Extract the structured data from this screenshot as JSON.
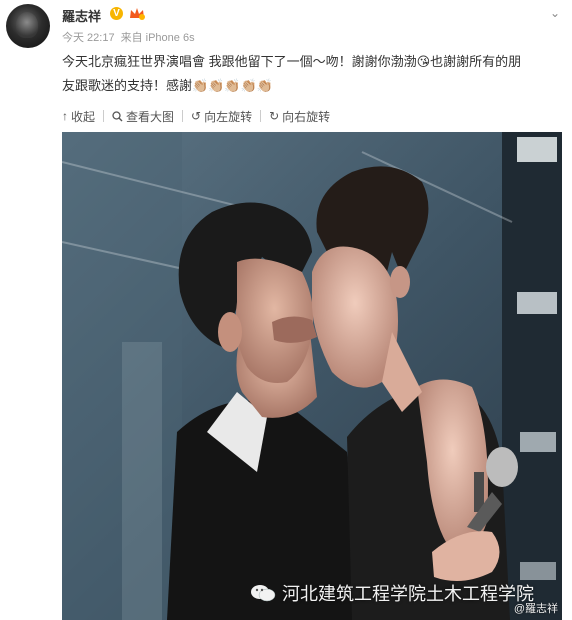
{
  "post": {
    "username": "羅志祥",
    "verified_badge": "V",
    "time": "今天 22:17",
    "via": "来自 iPhone 6s",
    "text_line1": "今天北京瘋狂世界演唱會 我跟他留下了一個～吻！謝謝你渤渤😘也謝謝所有的朋",
    "text_line2": "友跟歌迷的支持！感謝👏🏼👏🏼👏🏼👏🏼👏🏼"
  },
  "toolbar": {
    "collapse": "收起",
    "view_large": "查看大图",
    "rotate_left": "向左旋转",
    "rotate_right": "向右旋转"
  },
  "image": {
    "watermark_text": "河北建筑工程学院土木工程学院",
    "corner_user": "@羅志祥"
  },
  "icons": {
    "chevron": "chevron-down-icon",
    "collapse": "arrow-up-icon",
    "view_large": "magnifier-icon",
    "rotate_left": "rotate-left-icon",
    "rotate_right": "rotate-right-icon",
    "watermark": "wechat-icon"
  },
  "colors": {
    "badge": "#f7b500",
    "text": "#333333",
    "meta": "#9a9a9a"
  }
}
